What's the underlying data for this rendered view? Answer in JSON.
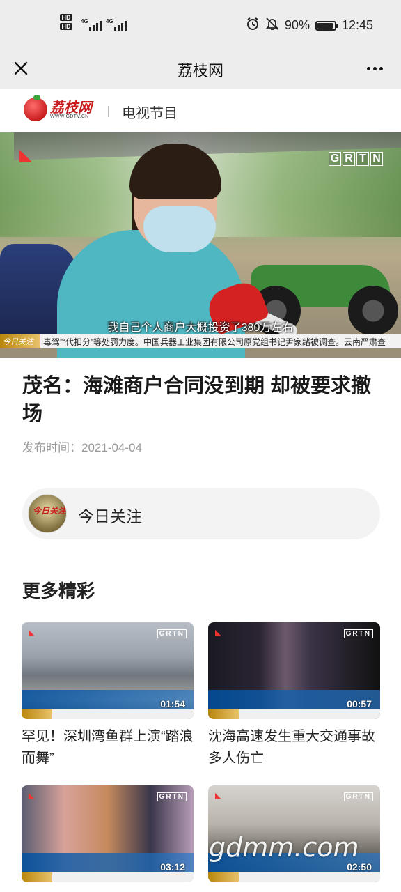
{
  "status_bar": {
    "network_left": "4G",
    "network_right": "4G",
    "battery_percent": "90%",
    "battery_level": 0.9,
    "time": "12:45",
    "icons": [
      "hd-icon",
      "signal-icon",
      "alarm-icon",
      "mute-icon",
      "battery-icon"
    ]
  },
  "nav": {
    "title": "荔枝网"
  },
  "brand": {
    "logo_text": "荔枝网",
    "logo_url": "WWW.GDTV.CN",
    "section": "电视节目"
  },
  "hero": {
    "grtn_letters": [
      "G",
      "R",
      "T",
      "N"
    ],
    "subtitle": "我自己个人商户大概投资了380万左右",
    "ticker_tag": "今日关注",
    "ticker_text": "毒驾”“代扣分”等处罚力度。中国兵器工业集团有限公司原党组书记尹家绪被调查。云南严肃查"
  },
  "article": {
    "title": "茂名：海滩商户合同没到期 却被要求撤场",
    "publish_label": "发布时间：",
    "publish_date": "2021-04-04"
  },
  "focus": {
    "label": "今日关注",
    "avatar_text": "今日关注"
  },
  "more": {
    "heading": "更多精彩",
    "videos": [
      {
        "title": "罕见！深圳湾鱼群上演“踏浪而舞”",
        "duration": "01:54",
        "grtn": "GRTN"
      },
      {
        "title": "沈海高速发生重大交通事故 多人伤亡",
        "duration": "00:57",
        "grtn": "GRTN"
      },
      {
        "title": "",
        "duration": "03:12",
        "grtn": "GRTN"
      },
      {
        "title": "",
        "duration": "02:50",
        "grtn": "GRTN"
      }
    ]
  },
  "watermark": "gdmm.com",
  "colors": {
    "status_bg": "#ededed",
    "accent_red": "#c81e1e",
    "muted_text": "#999999",
    "focus_card_bg": "#f3f3f3"
  }
}
